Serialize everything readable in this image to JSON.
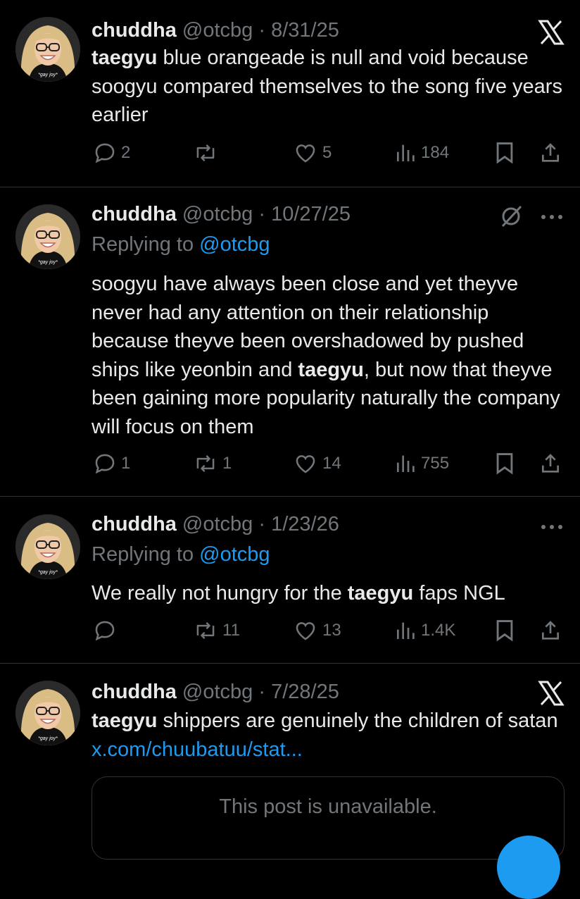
{
  "user": {
    "name": "chuddha",
    "handle": "@otcbg",
    "avatar_caption": "*gay joy*"
  },
  "tweets": [
    {
      "date": "8/31/25",
      "top_icon": "x-logo-icon",
      "body": {
        "b1": "taegyu",
        "t1": " blue orangeade is null and void because soogyu compared themselves to the song five years earlier"
      },
      "stats": {
        "replies": "2",
        "reposts": "",
        "likes": "5",
        "views": "184"
      }
    },
    {
      "date": "10/27/25",
      "top_icon": "grok-icon",
      "replying_label": "Replying to ",
      "replying_to": "@otcbg",
      "body": {
        "t1": "soogyu have always been close and yet theyve never had any attention on their relationship because theyve been overshadowed by pushed ships like yeonbin and ",
        "b1": "taegyu",
        "t2": ", but now that theyve been gaining more popularity naturally the company will focus on them"
      },
      "stats": {
        "replies": "1",
        "reposts": "1",
        "likes": "14",
        "views": "755"
      }
    },
    {
      "date": "1/23/26",
      "replying_label": "Replying to ",
      "replying_to": "@otcbg",
      "body": {
        "t1": "We really not hungry for the ",
        "b1": "taegyu",
        "t2": " faps NGL"
      },
      "stats": {
        "replies": "",
        "reposts": "11",
        "likes": "13",
        "views": "1.4K"
      }
    },
    {
      "date": "7/28/25",
      "top_icon": "x-logo-icon",
      "body": {
        "b1": "taegyu",
        "t1": " shippers are genuinely the children of satan ",
        "link": "x.com/chuubatuu/stat..."
      },
      "quote": "This post is unavailable."
    }
  ],
  "colors": {
    "background": "#000000",
    "text": "#e7e9ea",
    "muted": "#71767b",
    "accent": "#1d9bf0",
    "divider": "#2f3336"
  }
}
